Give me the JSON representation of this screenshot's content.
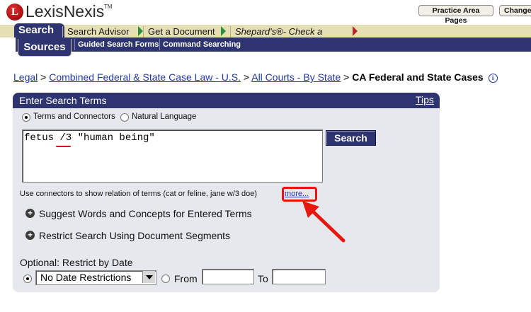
{
  "header": {
    "logo_mark": "L",
    "logo_text": "LexisNexis",
    "logo_tm": "TM",
    "links": [
      "Practice Area Pages",
      "Change"
    ]
  },
  "tabs": {
    "active": "Search",
    "items": [
      "Search Advisor",
      "Get a Document",
      "Shepard's®- Check a Citation"
    ]
  },
  "subtabs": {
    "active": "Sources",
    "items": [
      "Guided Search Forms",
      "Command Searching"
    ]
  },
  "breadcrumb": {
    "links": [
      "Legal",
      "Combined Federal & State Case Law - U.S.",
      "All Courts - By State"
    ],
    "separator": ">",
    "current": "CA Federal and State Cases",
    "info_icon": "info-icon"
  },
  "panel": {
    "title": "Enter Search Terms",
    "tips_label": "Tips",
    "search_type": {
      "options": [
        "Terms and Connectors",
        "Natural Language"
      ],
      "selected": "Terms and Connectors"
    },
    "query_value": "fetus /3 \"human being\"",
    "search_button": "Search",
    "hint_text": "Use connectors to show relation of terms (cat or feline, jane w/3 doe)",
    "more_link": "more...",
    "expanders": [
      "Suggest Words and Concepts for Entered Terms",
      "Restrict Search Using Document Segments"
    ],
    "date": {
      "label": "Optional: Restrict by Date",
      "select_value": "No Date Restrictions",
      "from_label": "From",
      "to_label": "To",
      "from_value": "",
      "to_value": "",
      "selected_option": "No Date Restrictions"
    }
  },
  "annotations": {
    "highlight_color": "#e5170f",
    "accent_color": "#2d3470"
  }
}
